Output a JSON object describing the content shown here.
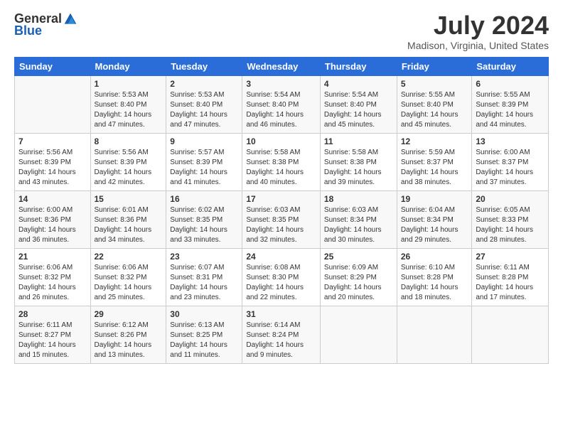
{
  "logo": {
    "general": "General",
    "blue": "Blue"
  },
  "header": {
    "month": "July 2024",
    "location": "Madison, Virginia, United States"
  },
  "days_of_week": [
    "Sunday",
    "Monday",
    "Tuesday",
    "Wednesday",
    "Thursday",
    "Friday",
    "Saturday"
  ],
  "weeks": [
    [
      {
        "day": "",
        "info": ""
      },
      {
        "day": "1",
        "info": "Sunrise: 5:53 AM\nSunset: 8:40 PM\nDaylight: 14 hours\nand 47 minutes."
      },
      {
        "day": "2",
        "info": "Sunrise: 5:53 AM\nSunset: 8:40 PM\nDaylight: 14 hours\nand 47 minutes."
      },
      {
        "day": "3",
        "info": "Sunrise: 5:54 AM\nSunset: 8:40 PM\nDaylight: 14 hours\nand 46 minutes."
      },
      {
        "day": "4",
        "info": "Sunrise: 5:54 AM\nSunset: 8:40 PM\nDaylight: 14 hours\nand 45 minutes."
      },
      {
        "day": "5",
        "info": "Sunrise: 5:55 AM\nSunset: 8:40 PM\nDaylight: 14 hours\nand 45 minutes."
      },
      {
        "day": "6",
        "info": "Sunrise: 5:55 AM\nSunset: 8:39 PM\nDaylight: 14 hours\nand 44 minutes."
      }
    ],
    [
      {
        "day": "7",
        "info": "Sunrise: 5:56 AM\nSunset: 8:39 PM\nDaylight: 14 hours\nand 43 minutes."
      },
      {
        "day": "8",
        "info": "Sunrise: 5:56 AM\nSunset: 8:39 PM\nDaylight: 14 hours\nand 42 minutes."
      },
      {
        "day": "9",
        "info": "Sunrise: 5:57 AM\nSunset: 8:39 PM\nDaylight: 14 hours\nand 41 minutes."
      },
      {
        "day": "10",
        "info": "Sunrise: 5:58 AM\nSunset: 8:38 PM\nDaylight: 14 hours\nand 40 minutes."
      },
      {
        "day": "11",
        "info": "Sunrise: 5:58 AM\nSunset: 8:38 PM\nDaylight: 14 hours\nand 39 minutes."
      },
      {
        "day": "12",
        "info": "Sunrise: 5:59 AM\nSunset: 8:37 PM\nDaylight: 14 hours\nand 38 minutes."
      },
      {
        "day": "13",
        "info": "Sunrise: 6:00 AM\nSunset: 8:37 PM\nDaylight: 14 hours\nand 37 minutes."
      }
    ],
    [
      {
        "day": "14",
        "info": "Sunrise: 6:00 AM\nSunset: 8:36 PM\nDaylight: 14 hours\nand 36 minutes."
      },
      {
        "day": "15",
        "info": "Sunrise: 6:01 AM\nSunset: 8:36 PM\nDaylight: 14 hours\nand 34 minutes."
      },
      {
        "day": "16",
        "info": "Sunrise: 6:02 AM\nSunset: 8:35 PM\nDaylight: 14 hours\nand 33 minutes."
      },
      {
        "day": "17",
        "info": "Sunrise: 6:03 AM\nSunset: 8:35 PM\nDaylight: 14 hours\nand 32 minutes."
      },
      {
        "day": "18",
        "info": "Sunrise: 6:03 AM\nSunset: 8:34 PM\nDaylight: 14 hours\nand 30 minutes."
      },
      {
        "day": "19",
        "info": "Sunrise: 6:04 AM\nSunset: 8:34 PM\nDaylight: 14 hours\nand 29 minutes."
      },
      {
        "day": "20",
        "info": "Sunrise: 6:05 AM\nSunset: 8:33 PM\nDaylight: 14 hours\nand 28 minutes."
      }
    ],
    [
      {
        "day": "21",
        "info": "Sunrise: 6:06 AM\nSunset: 8:32 PM\nDaylight: 14 hours\nand 26 minutes."
      },
      {
        "day": "22",
        "info": "Sunrise: 6:06 AM\nSunset: 8:32 PM\nDaylight: 14 hours\nand 25 minutes."
      },
      {
        "day": "23",
        "info": "Sunrise: 6:07 AM\nSunset: 8:31 PM\nDaylight: 14 hours\nand 23 minutes."
      },
      {
        "day": "24",
        "info": "Sunrise: 6:08 AM\nSunset: 8:30 PM\nDaylight: 14 hours\nand 22 minutes."
      },
      {
        "day": "25",
        "info": "Sunrise: 6:09 AM\nSunset: 8:29 PM\nDaylight: 14 hours\nand 20 minutes."
      },
      {
        "day": "26",
        "info": "Sunrise: 6:10 AM\nSunset: 8:28 PM\nDaylight: 14 hours\nand 18 minutes."
      },
      {
        "day": "27",
        "info": "Sunrise: 6:11 AM\nSunset: 8:28 PM\nDaylight: 14 hours\nand 17 minutes."
      }
    ],
    [
      {
        "day": "28",
        "info": "Sunrise: 6:11 AM\nSunset: 8:27 PM\nDaylight: 14 hours\nand 15 minutes."
      },
      {
        "day": "29",
        "info": "Sunrise: 6:12 AM\nSunset: 8:26 PM\nDaylight: 14 hours\nand 13 minutes."
      },
      {
        "day": "30",
        "info": "Sunrise: 6:13 AM\nSunset: 8:25 PM\nDaylight: 14 hours\nand 11 minutes."
      },
      {
        "day": "31",
        "info": "Sunrise: 6:14 AM\nSunset: 8:24 PM\nDaylight: 14 hours\nand 9 minutes."
      },
      {
        "day": "",
        "info": ""
      },
      {
        "day": "",
        "info": ""
      },
      {
        "day": "",
        "info": ""
      }
    ]
  ]
}
